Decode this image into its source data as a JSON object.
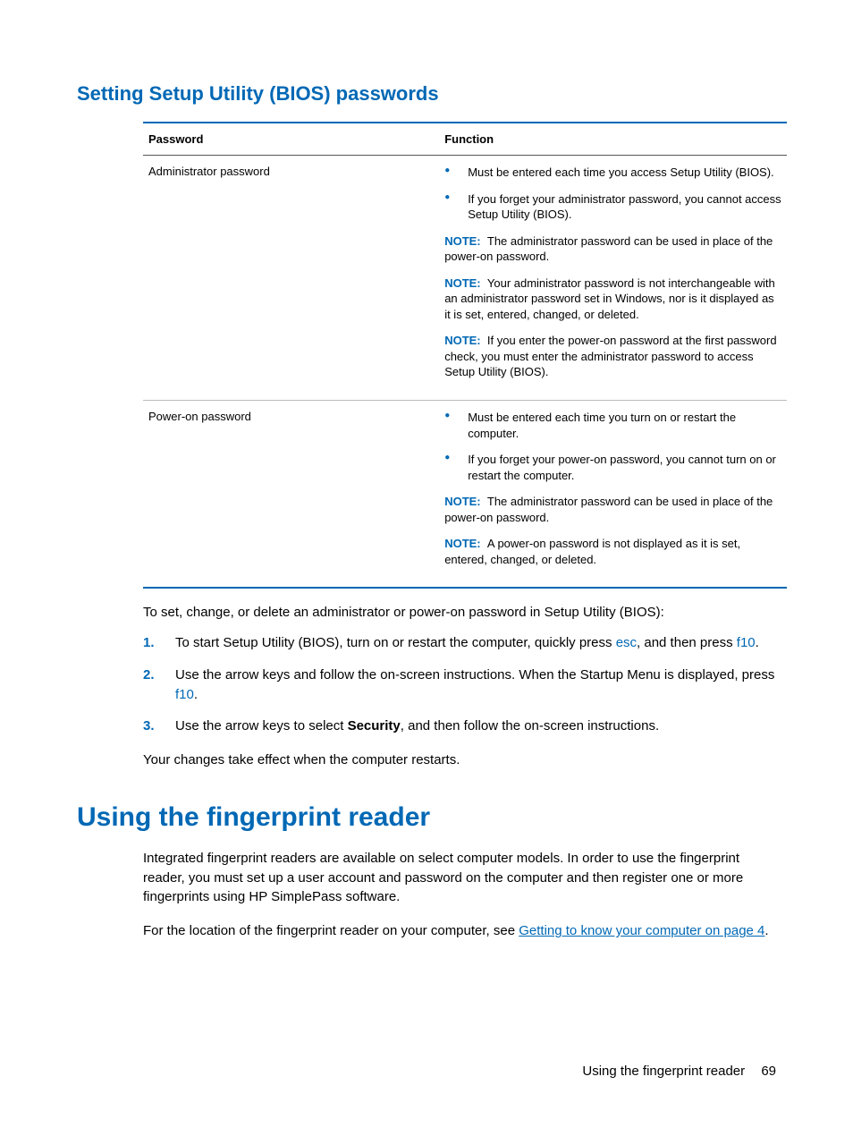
{
  "heading1": "Setting Setup Utility (BIOS) passwords",
  "table": {
    "head": {
      "c1": "Password",
      "c2": "Function"
    },
    "rows": [
      {
        "name": "Administrator password",
        "bullets": [
          "Must be entered each time you access Setup Utility (BIOS).",
          "If you forget your administrator password, you cannot access Setup Utility (BIOS)."
        ],
        "notes": [
          "The administrator password can be used in place of the power-on password.",
          "Your administrator password is not interchangeable with an administrator password set in Windows, nor is it displayed as it is set, entered, changed, or deleted.",
          "If you enter the power-on password at the first password check, you must enter the administrator password to access Setup Utility (BIOS)."
        ]
      },
      {
        "name": "Power-on password",
        "bullets": [
          "Must be entered each time you turn on or restart the computer.",
          "If you forget your power-on password, you cannot turn on or restart the computer."
        ],
        "notes": [
          "The administrator password can be used in place of the power-on password.",
          "A power-on password is not displayed as it is set, entered, changed, or deleted."
        ]
      }
    ]
  },
  "note_label": "NOTE:",
  "intro_para": "To set, change, or delete an administrator or power-on password in Setup Utility (BIOS):",
  "steps": [
    {
      "pre": "To start Setup Utility (BIOS), turn on or restart the computer, quickly press ",
      "k1": "esc",
      "mid": ", and then press ",
      "k2": "f10",
      "post": "."
    },
    {
      "pre": "Use the arrow keys and follow the on-screen instructions. When the Startup Menu is displayed, press ",
      "k1": "f10",
      "mid": "",
      "k2": "",
      "post": "."
    },
    {
      "pre": "Use the arrow keys to select ",
      "bold": "Security",
      "post": ", and then follow the on-screen instructions."
    }
  ],
  "after_steps": "Your changes take effect when the computer restarts.",
  "heading2": "Using the fingerprint reader",
  "fp_para1": "Integrated fingerprint readers are available on select computer models. In order to use the fingerprint reader, you must set up a user account and password on the computer and then register one or more fingerprints using HP SimplePass software.",
  "fp_para2_pre": "For the location of the fingerprint reader on your computer, see ",
  "fp_link": "Getting to know your computer on page 4",
  "fp_para2_post": ".",
  "footer_text": "Using the fingerprint reader",
  "page_number": "69"
}
